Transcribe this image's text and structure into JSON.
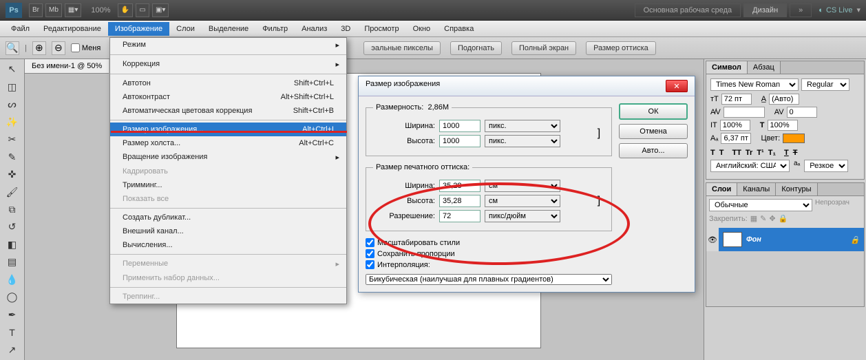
{
  "top": {
    "logo": "Ps",
    "zoom": "100%",
    "workspace_primary": "Основная рабочая среда",
    "workspace_design": "Дизайн",
    "cs_live": "CS Live"
  },
  "menubar": {
    "items": [
      "Файл",
      "Редактирование",
      "Изображение",
      "Слои",
      "Выделение",
      "Фильтр",
      "Анализ",
      "3D",
      "Просмотр",
      "Окно",
      "Справка"
    ]
  },
  "options": {
    "checkbox_label": "Меня",
    "real_pixels": "эальные пикселы",
    "fit": "Подогнать",
    "fullscreen": "Полный экран",
    "print_size": "Размер оттиска"
  },
  "doc_tab": "Без имени-1 @ 50%",
  "dropdown": {
    "items": [
      {
        "label": "Режим",
        "arrow": true
      },
      {
        "sep": true
      },
      {
        "label": "Коррекция",
        "arrow": true
      },
      {
        "sep": true
      },
      {
        "label": "Автотон",
        "shortcut": "Shift+Ctrl+L"
      },
      {
        "label": "Автоконтраст",
        "shortcut": "Alt+Shift+Ctrl+L"
      },
      {
        "label": "Автоматическая цветовая коррекция",
        "shortcut": "Shift+Ctrl+B"
      },
      {
        "sep": true
      },
      {
        "label": "Размер изображения...",
        "shortcut": "Alt+Ctrl+I",
        "highlighted": true
      },
      {
        "label": "Размер холста...",
        "shortcut": "Alt+Ctrl+C"
      },
      {
        "label": "Вращение изображения",
        "arrow": true
      },
      {
        "label": "Кадрировать",
        "disabled": true
      },
      {
        "label": "Тримминг..."
      },
      {
        "label": "Показать все",
        "disabled": true
      },
      {
        "sep": true
      },
      {
        "label": "Создать дубликат..."
      },
      {
        "label": "Внешний канал..."
      },
      {
        "label": "Вычисления..."
      },
      {
        "sep": true
      },
      {
        "label": "Переменные",
        "arrow": true,
        "disabled": true
      },
      {
        "label": "Применить набор данных...",
        "disabled": true
      },
      {
        "sep": true
      },
      {
        "label": "Треппинг...",
        "disabled": true
      }
    ]
  },
  "dialog": {
    "title": "Размер изображения",
    "dim_label": "Размерность:",
    "dim_value": "2,86M",
    "width_label": "Ширина:",
    "height_label": "Высота:",
    "width_val": "1000",
    "height_val": "1000",
    "unit_px": "пикс.",
    "print_legend": "Размер печатного оттиска:",
    "print_width": "35,28",
    "print_height": "35,28",
    "unit_cm": "см",
    "res_label": "Разрешение:",
    "res_val": "72",
    "unit_ppi": "пикс/дюйм",
    "scale_styles": "Масштабировать стили",
    "keep_prop": "Сохранить пропорции",
    "interp": "Интерполяция:",
    "interp_method": "Бикубическая (наилучшая для плавных градиентов)",
    "ok": "ОК",
    "cancel": "Отмена",
    "auto": "Авто..."
  },
  "panels": {
    "char_tab": "Символ",
    "para_tab": "Абзац",
    "font_name": "Times New Roman",
    "font_style": "Regular",
    "size": "72 пт",
    "leading": "(Авто)",
    "tracking": "0",
    "scale": "100%",
    "scale2": "100%",
    "baseline": "6,37 пт",
    "color_label": "Цвет:",
    "lang": "Английский: США",
    "aa": "Резкое",
    "layers_tab": "Слои",
    "channels_tab": "Каналы",
    "paths_tab": "Контуры",
    "blend_mode": "Обычные",
    "opacity_label": "Непрозрач",
    "lock_label": "Закрепить:",
    "layer_name": "Фон"
  }
}
